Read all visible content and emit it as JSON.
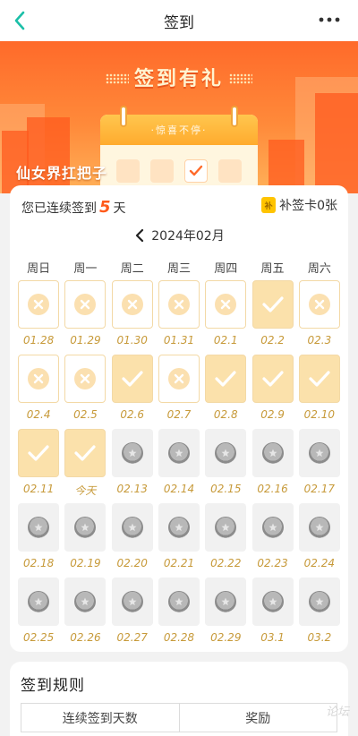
{
  "topbar": {
    "title": "签到",
    "back_icon": "chevron-left-icon",
    "more_icon": "more-icon"
  },
  "banner": {
    "title": "签到有礼",
    "calendar_label": "·惊喜不停·",
    "username": "仙女界扛把子"
  },
  "streak": {
    "prefix": "您已连续签到",
    "count": "5",
    "suffix": "天"
  },
  "makeup_card": {
    "label": "补签卡0张"
  },
  "month": {
    "label": "2024年02月"
  },
  "weekdays": [
    "周日",
    "周一",
    "周二",
    "周三",
    "周四",
    "周五",
    "周六"
  ],
  "days": [
    {
      "date": "01.28",
      "status": "missed"
    },
    {
      "date": "01.29",
      "status": "missed"
    },
    {
      "date": "01.30",
      "status": "missed"
    },
    {
      "date": "01.31",
      "status": "missed"
    },
    {
      "date": "02.1",
      "status": "missed"
    },
    {
      "date": "02.2",
      "status": "signed"
    },
    {
      "date": "02.3",
      "status": "missed"
    },
    {
      "date": "02.4",
      "status": "missed"
    },
    {
      "date": "02.5",
      "status": "missed"
    },
    {
      "date": "02.6",
      "status": "signed"
    },
    {
      "date": "02.7",
      "status": "missed"
    },
    {
      "date": "02.8",
      "status": "signed"
    },
    {
      "date": "02.9",
      "status": "signed"
    },
    {
      "date": "02.10",
      "status": "signed"
    },
    {
      "date": "02.11",
      "status": "signed"
    },
    {
      "date": "今天",
      "status": "signed"
    },
    {
      "date": "02.13",
      "status": "future"
    },
    {
      "date": "02.14",
      "status": "future"
    },
    {
      "date": "02.15",
      "status": "future"
    },
    {
      "date": "02.16",
      "status": "future"
    },
    {
      "date": "02.17",
      "status": "future"
    },
    {
      "date": "02.18",
      "status": "future"
    },
    {
      "date": "02.19",
      "status": "future"
    },
    {
      "date": "02.20",
      "status": "future"
    },
    {
      "date": "02.21",
      "status": "future"
    },
    {
      "date": "02.22",
      "status": "future"
    },
    {
      "date": "02.23",
      "status": "future"
    },
    {
      "date": "02.24",
      "status": "future"
    },
    {
      "date": "02.25",
      "status": "future"
    },
    {
      "date": "02.26",
      "status": "future"
    },
    {
      "date": "02.27",
      "status": "future"
    },
    {
      "date": "02.28",
      "status": "future"
    },
    {
      "date": "02.29",
      "status": "future"
    },
    {
      "date": "03.1",
      "status": "future"
    },
    {
      "date": "03.2",
      "status": "future"
    }
  ],
  "rules": {
    "title": "签到规则",
    "headers": [
      "连续签到天数",
      "奖励"
    ]
  },
  "watermark": "论坛",
  "colors": {
    "accent": "#ff5a1a",
    "signed_tile": "#fbe1ab",
    "date_text": "#c79a3a",
    "banner": "#ff6a2a"
  }
}
